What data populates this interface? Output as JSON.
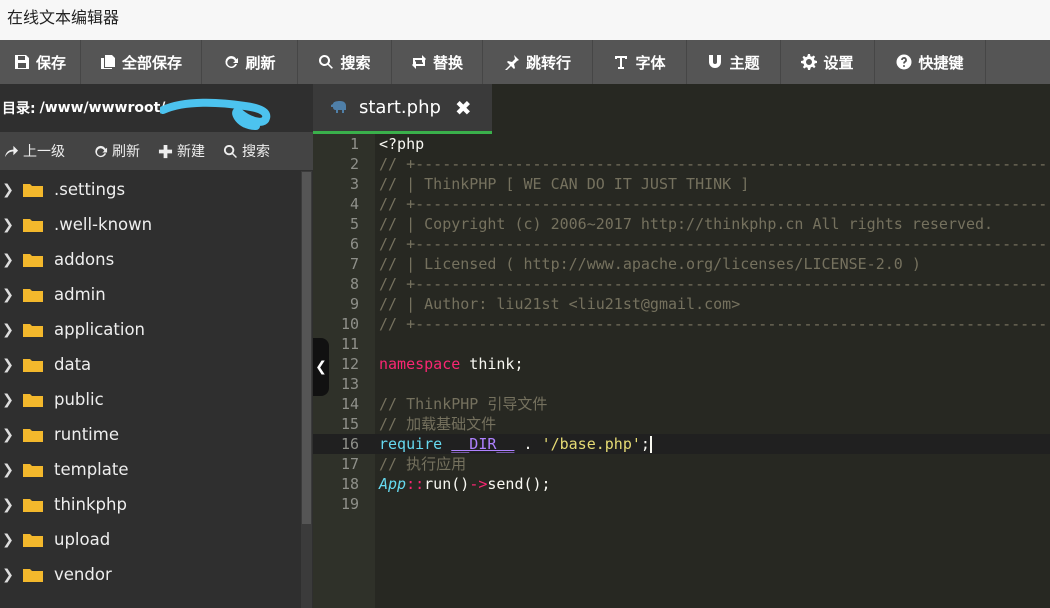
{
  "window": {
    "title": "在线文本编辑器"
  },
  "toolbar": [
    {
      "label": "保存",
      "icon": "floppy-icon"
    },
    {
      "label": "全部保存",
      "icon": "copy-icon"
    },
    {
      "label": "刷新",
      "icon": "refresh-icon"
    },
    {
      "label": "搜索",
      "icon": "search-icon"
    },
    {
      "label": "替换",
      "icon": "replace-icon"
    },
    {
      "label": "跳转行",
      "icon": "pin-icon"
    },
    {
      "label": "字体",
      "icon": "text-icon"
    },
    {
      "label": "主题",
      "icon": "magnet-icon"
    },
    {
      "label": "设置",
      "icon": "gear-icon"
    },
    {
      "label": "快捷键",
      "icon": "question-icon"
    }
  ],
  "sidebar": {
    "dir_label": "目录:",
    "dir_path": "/www/wwwroot/",
    "actions": [
      {
        "label": "上一级",
        "icon": "up-level-icon"
      },
      {
        "label": "刷新",
        "icon": "refresh-icon"
      },
      {
        "label": "新建",
        "icon": "plus-icon"
      },
      {
        "label": "搜索",
        "icon": "search-icon"
      }
    ],
    "folders": [
      ".settings",
      ".well-known",
      "addons",
      "admin",
      "application",
      "data",
      "public",
      "runtime",
      "template",
      "thinkphp",
      "upload",
      "vendor"
    ]
  },
  "editor": {
    "tab_name": "start.php",
    "close_glyph": "✖",
    "collapse_glyph": "❮",
    "lines": [
      {
        "n": "1",
        "t": "<?php"
      },
      {
        "n": "2",
        "t": "// +----------------------------------------------------------------------"
      },
      {
        "n": "3",
        "t": "// | ThinkPHP [ WE CAN DO IT JUST THINK ]"
      },
      {
        "n": "4",
        "t": "// +----------------------------------------------------------------------"
      },
      {
        "n": "5",
        "t": "// | Copyright (c) 2006~2017 http://thinkphp.cn All rights reserved."
      },
      {
        "n": "6",
        "t": "// +----------------------------------------------------------------------"
      },
      {
        "n": "7",
        "t": "// | Licensed ( http://www.apache.org/licenses/LICENSE-2.0 )"
      },
      {
        "n": "8",
        "t": "// +----------------------------------------------------------------------"
      },
      {
        "n": "9",
        "t": "// | Author: liu21st <liu21st@gmail.com>"
      },
      {
        "n": "10",
        "t": "// +----------------------------------------------------------------------"
      },
      {
        "n": "11",
        "t": ""
      },
      {
        "n": "12",
        "t": "namespace think;"
      },
      {
        "n": "13",
        "t": ""
      },
      {
        "n": "14",
        "t": "// ThinkPHP 引导文件"
      },
      {
        "n": "15",
        "t": "// 加载基础文件"
      },
      {
        "n": "16",
        "t": "require __DIR__ . '/base.php';"
      },
      {
        "n": "17",
        "t": "// 执行应用"
      },
      {
        "n": "18",
        "t": "App::run()->send();"
      },
      {
        "n": "19",
        "t": ""
      }
    ]
  },
  "colors": {
    "toolbar_bg": "#555555",
    "sidebar_bg": "#2f2f2f",
    "editor_bg": "#272822",
    "tab_accent": "#3ab04b",
    "folder": "#f3b82c"
  }
}
